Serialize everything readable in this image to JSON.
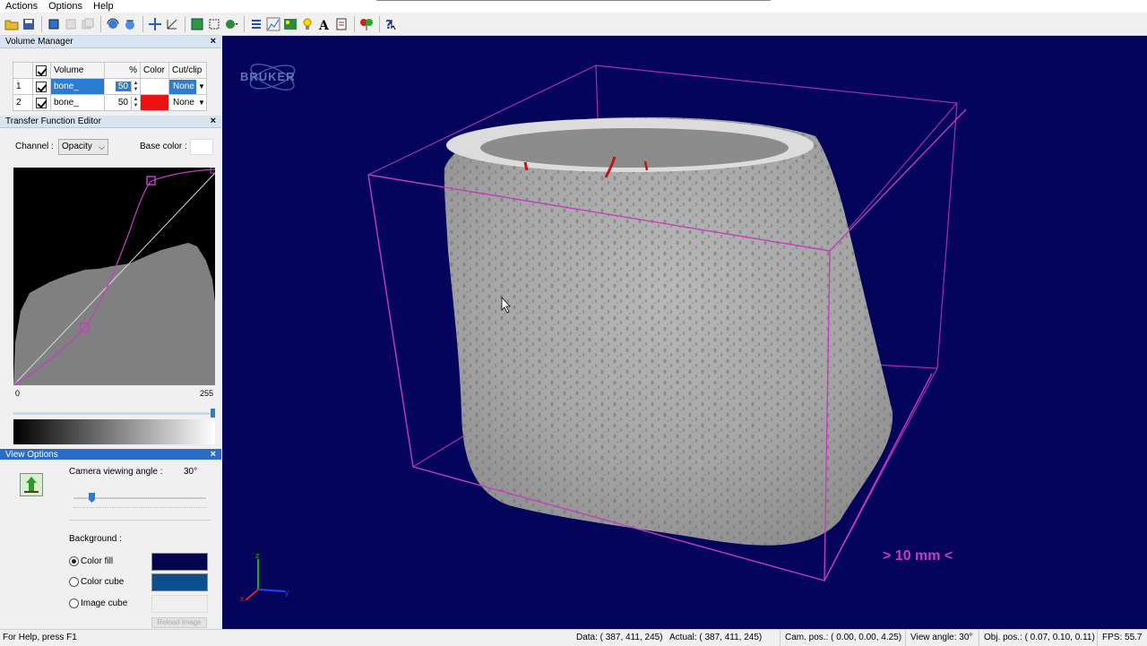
{
  "menu": [
    "Actions",
    "Options",
    "Help"
  ],
  "toolbar": [
    {
      "name": "open-icon"
    },
    {
      "name": "save-icon"
    },
    {
      "name": "sep"
    },
    {
      "name": "cube-icon"
    },
    {
      "name": "cube-outline-icon",
      "disabled": true
    },
    {
      "name": "cube-stack-icon",
      "disabled": true
    },
    {
      "name": "sep"
    },
    {
      "name": "rotate-icon"
    },
    {
      "name": "rotate-object-icon"
    },
    {
      "name": "sep"
    },
    {
      "name": "move-icon"
    },
    {
      "name": "axes-icon"
    },
    {
      "name": "sep"
    },
    {
      "name": "box-green-icon"
    },
    {
      "name": "crop-icon"
    },
    {
      "name": "objects-dropdown-icon"
    },
    {
      "name": "sep"
    },
    {
      "name": "list-icon"
    },
    {
      "name": "chart-icon"
    },
    {
      "name": "image-icon"
    },
    {
      "name": "light-icon"
    },
    {
      "name": "text-icon"
    },
    {
      "name": "clip-icon"
    },
    {
      "name": "sep"
    },
    {
      "name": "balloon-icon"
    },
    {
      "name": "sep"
    },
    {
      "name": "help-pointer-icon"
    }
  ],
  "volume_manager": {
    "title": "Volume Manager",
    "headers": [
      "",
      "",
      "Volume",
      "%",
      "Color",
      "Cut/clip"
    ],
    "rows": [
      {
        "index": "1",
        "name": "bone_",
        "percent": "50",
        "color": "#ffffff",
        "cut": "None",
        "selected": true
      },
      {
        "index": "2",
        "name": "bone_",
        "percent": "50",
        "color": "#ee1111",
        "cut": "None",
        "selected": false
      }
    ]
  },
  "transfer_function": {
    "title": "Transfer Function Editor",
    "channel_label": "Channel :",
    "channel_value": "Opacity",
    "base_color_label": "Base color :",
    "min_label": "0",
    "max_label": "255"
  },
  "view_options": {
    "title": "View Options",
    "camera_label": "Camera viewing angle :",
    "camera_value": "30°",
    "background_label": "Background :",
    "options": [
      {
        "label": "Color fill",
        "checked": true,
        "swatch": "#04044e"
      },
      {
        "label": "Color cube",
        "checked": false,
        "swatch": "#0d4f8c"
      },
      {
        "label": "Image cube",
        "checked": false,
        "swatch": "#f0f0f0"
      }
    ],
    "reload_label": "Reload image"
  },
  "viewport": {
    "brand": "BRUKER",
    "scale_label": "> 10 mm <",
    "axis_labels": {
      "z": "z",
      "x": "x",
      "y": "y"
    },
    "background": "#04045a",
    "accent": "#c23ec2"
  },
  "status": {
    "help": "For Help, press F1",
    "data": "Data: ( 387,  411,  245)",
    "actual": "Actual: ( 387,  411,  245)",
    "cam_pos": "Cam. pos.: ( 0.00,  0.00,  4.25)",
    "view_angle": "View angle: 30°",
    "obj_pos": "Obj. pos.: ( 0.07,  0.10,  0.11)",
    "fps": "FPS: 55.7"
  }
}
